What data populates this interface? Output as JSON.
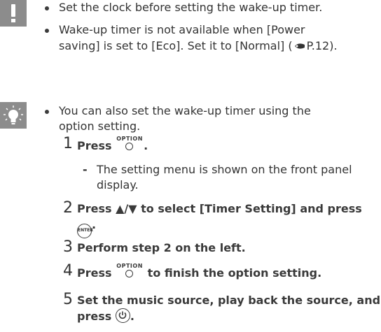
{
  "caution": {
    "icon": "exclamation-icon",
    "items": [
      "Set the clock before setting the wake-up timer.",
      "Wake-up timer is not available when [Power",
      "saving] is set to [Eco]. Set it to [Normal] (",
      "P.12)."
    ]
  },
  "tip": {
    "icon": "lightbulb-icon",
    "intro_line1": "You can also set the wake-up timer using the",
    "intro_line2": "option setting.",
    "steps": [
      {
        "num": "1",
        "pre": "Press",
        "post": "."
      },
      {
        "num": "2",
        "line1": "Press ▲/▼ to select [Timer Setting] and press",
        "post": "."
      },
      {
        "num": "3",
        "text": "Perform step 2 on the left."
      },
      {
        "num": "4",
        "pre": "Press",
        "post": "to finish the option setting."
      },
      {
        "num": "5",
        "line1": "Set the music source, play back the source, and",
        "pre": "press",
        "post": "."
      }
    ],
    "sub_note_line1": "The setting menu is shown on the front panel",
    "sub_note_line2": "display.",
    "option_label": "OPTION",
    "enter_label": "ENTER"
  },
  "colors": {
    "icon_bg": "#8c8c8c",
    "text": "#333333"
  }
}
